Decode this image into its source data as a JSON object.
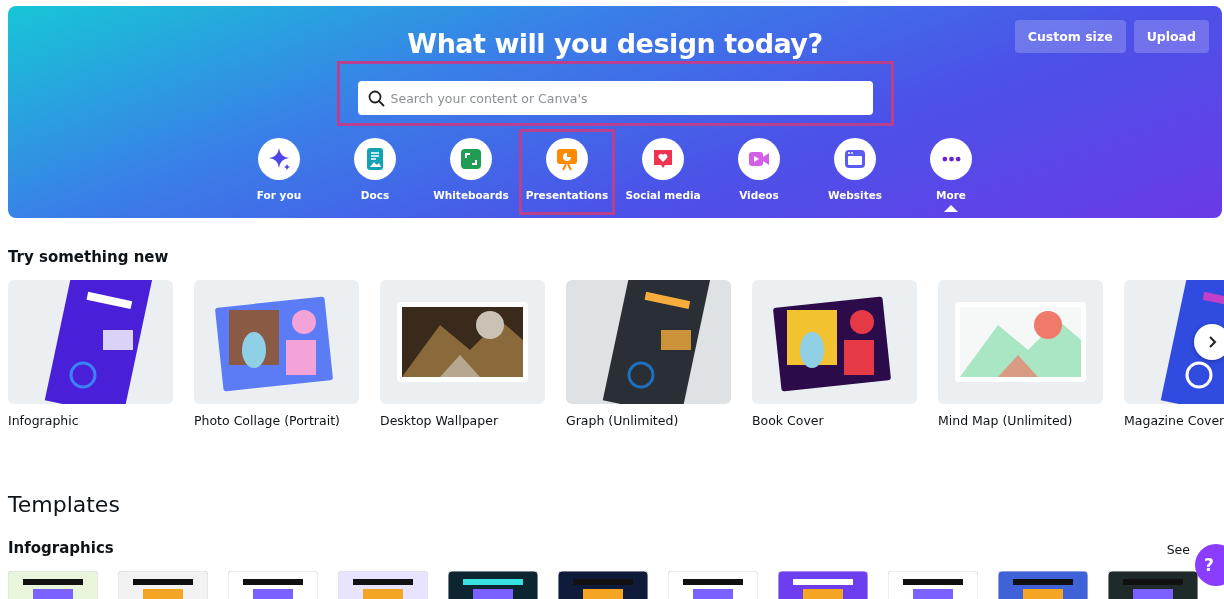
{
  "hero": {
    "title": "What will you design today?",
    "buttons": [
      "Custom size",
      "Upload"
    ],
    "search": {
      "placeholder": "Search your content or Canva's",
      "highlighted": true
    },
    "categories": [
      {
        "label": "For you",
        "selected": false,
        "highlighted": false
      },
      {
        "label": "Docs",
        "selected": false,
        "highlighted": false
      },
      {
        "label": "Whiteboards",
        "selected": false,
        "highlighted": false
      },
      {
        "label": "Presentations",
        "selected": false,
        "highlighted": true
      },
      {
        "label": "Social media",
        "selected": false,
        "highlighted": false
      },
      {
        "label": "Videos",
        "selected": false,
        "highlighted": false
      },
      {
        "label": "Websites",
        "selected": false,
        "highlighted": false
      },
      {
        "label": "More",
        "selected": true,
        "highlighted": false
      }
    ]
  },
  "try_something_new": {
    "heading": "Try something new",
    "items": [
      {
        "label": "Infographic",
        "kind": "picture"
      },
      {
        "label": "Photo Collage (Portrait)",
        "kind": "picture"
      },
      {
        "label": "Desktop Wallpaper",
        "kind": "picture"
      },
      {
        "label": "Graph (Unlimited)",
        "kind": "picture"
      },
      {
        "label": "Book Cover",
        "kind": "picture"
      },
      {
        "label": "Mind Map (Unlimited)",
        "kind": "picture"
      },
      {
        "label": "Magazine Cover",
        "kind": "picture"
      }
    ]
  },
  "templates": {
    "heading": "Templates",
    "section": "Infographics",
    "see_all": "See"
  },
  "help_button": "?"
}
